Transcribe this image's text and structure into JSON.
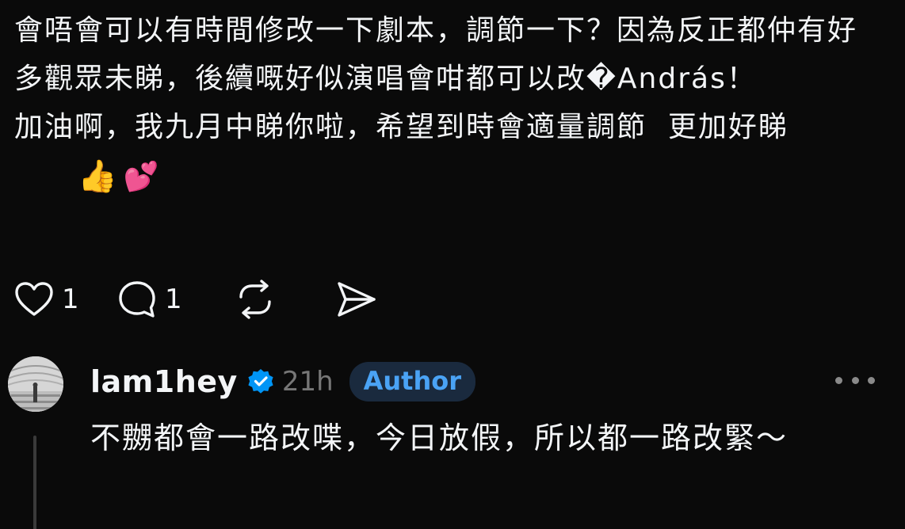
{
  "post": {
    "paragraph_1": "會唔會可以有時間修改一下劇本，調節一下？因為反正都仲有好多觀眾未睇，後續嘅好似演唱會咁都可以改�András！",
    "paragraph_2": "加油啊，我九月中睇你啦，希望到時會適量調節  更加好睇",
    "emoji_1": "👍",
    "emoji_2": "💕"
  },
  "actions": {
    "like_icon": "heart-icon",
    "like_count": "1",
    "reply_icon": "comment-icon",
    "reply_count": "1",
    "repost_icon": "repost-icon",
    "share_icon": "send-icon"
  },
  "reply": {
    "username": "lam1hey",
    "verified_icon": "verified-badge-icon",
    "time": "21h",
    "badge": "Author",
    "text": "不嬲都會一路改喋，今日放假，所以都一路改緊～",
    "more_icon": "more-options-icon"
  },
  "colors": {
    "background": "#0a0a0a",
    "text": "#f3f5f7",
    "muted": "#777777",
    "accent": "#4aa3f5",
    "badge_bg": "#1a2a3e",
    "verified": "#0095f6"
  }
}
